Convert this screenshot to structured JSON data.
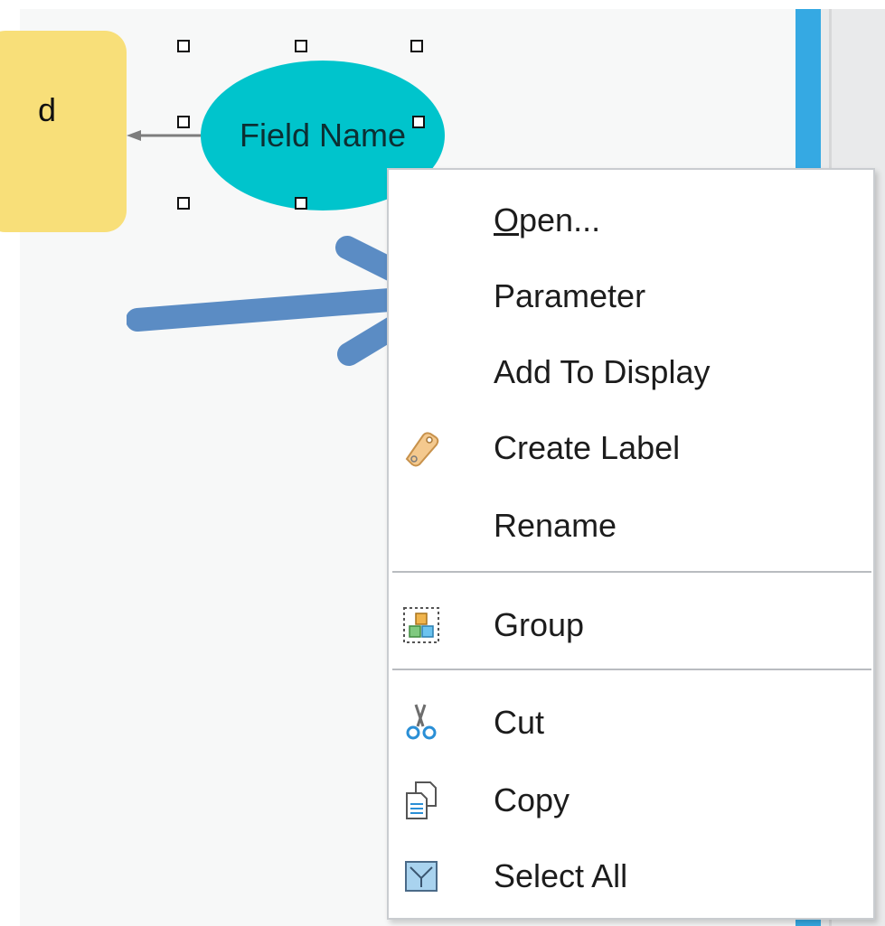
{
  "canvas": {
    "process_text": "d",
    "variable_label": "Field Name"
  },
  "context_menu": {
    "items": [
      {
        "label": "Open...",
        "icon": "none"
      },
      {
        "label": "Parameter",
        "icon": "none"
      },
      {
        "label": "Add To Display",
        "icon": "none"
      },
      {
        "label": "Create Label",
        "icon": "label-tag-icon"
      },
      {
        "label": "Rename",
        "icon": "none"
      },
      {
        "label": "Group",
        "icon": "group-icon"
      },
      {
        "label": "Cut",
        "icon": "scissors-icon"
      },
      {
        "label": "Copy",
        "icon": "copy-icon"
      },
      {
        "label": "Select All",
        "icon": "select-all-icon"
      }
    ],
    "separators_after": [
      "Rename",
      "Group"
    ]
  },
  "colors": {
    "ellipse": "#00c4cc",
    "process_box": "#f8df79",
    "annotation_arrow": "#5b8cc4",
    "side_bar": "#35a9e3"
  }
}
